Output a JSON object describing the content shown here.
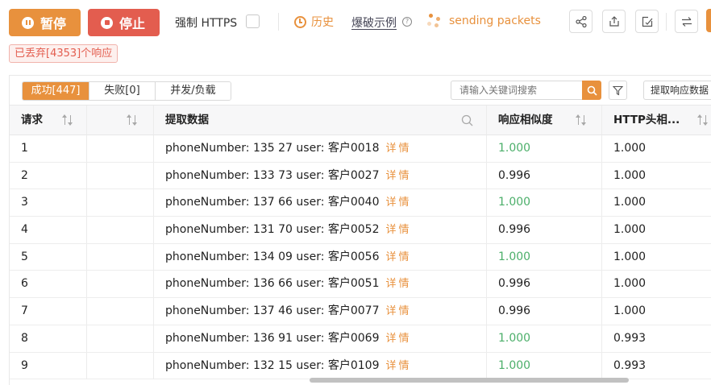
{
  "toolbar": {
    "pause_label": "暂停",
    "stop_label": "停止",
    "https_label": "强制 HTTPS",
    "https_checked": false,
    "history_label": "历史",
    "example_label": "爆破示例",
    "status_text": "sending packets",
    "icons": [
      "share-icon",
      "export-icon",
      "edit-icon",
      "swap-icon"
    ],
    "accent_color": "#e8913d",
    "danger_color": "#e35d4f"
  },
  "dropped": "已丢弃[4353]个响应",
  "tabs": [
    {
      "label": "成功[447]",
      "active": true
    },
    {
      "label": "失败[0]",
      "active": false
    },
    {
      "label": "并发/负载",
      "active": false
    }
  ],
  "search": {
    "placeholder": "请输入关键词搜索"
  },
  "extract_button": "提取响应数据",
  "table": {
    "headers": [
      "请求",
      "",
      "提取数据",
      "响应相似度",
      "HTTP头相..."
    ],
    "detail_label": "详情",
    "rows": [
      {
        "id": "1",
        "data": "phoneNumber: 135      27 user: 客户0018",
        "sim": "1.000",
        "http": "1.000"
      },
      {
        "id": "2",
        "data": "phoneNumber: 133      73 user: 客户0027",
        "sim": "0.996",
        "http": "1.000"
      },
      {
        "id": "3",
        "data": "phoneNumber: 137      66 user: 客户0040",
        "sim": "1.000",
        "http": "1.000"
      },
      {
        "id": "4",
        "data": "phoneNumber: 131      70 user: 客户0052",
        "sim": "0.996",
        "http": "1.000"
      },
      {
        "id": "5",
        "data": "phoneNumber: 134      09 user: 客户0056",
        "sim": "1.000",
        "http": "1.000"
      },
      {
        "id": "6",
        "data": "phoneNumber: 136      66 user: 客户0051",
        "sim": "0.996",
        "http": "1.000"
      },
      {
        "id": "7",
        "data": "phoneNumber: 137      46 user: 客户0077",
        "sim": "0.996",
        "http": "1.000"
      },
      {
        "id": "8",
        "data": "phoneNumber: 136      91 user: 客户0069",
        "sim": "1.000",
        "http": "0.993"
      },
      {
        "id": "9",
        "data": "phoneNumber: 132      15 user: 客户0109",
        "sim": "1.000",
        "http": "0.993"
      }
    ]
  }
}
